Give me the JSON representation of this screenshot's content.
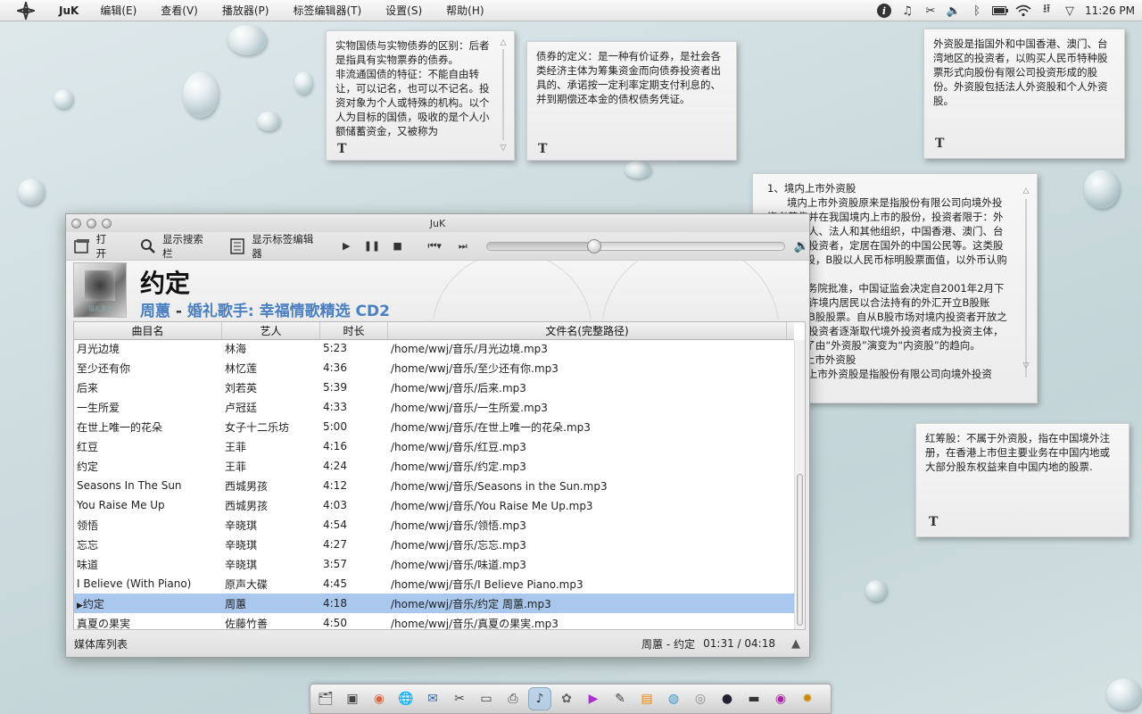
{
  "menubar": {
    "app_name": "JuK",
    "menus": [
      "编辑(E)",
      "查看(V)",
      "播放器(P)",
      "标签编辑器(T)",
      "设置(S)",
      "帮助(H)"
    ],
    "tray_icons": [
      "info-icon",
      "music-note-icon",
      "scissors-icon",
      "volume-icon",
      "bluetooth-icon",
      "battery-icon",
      "wifi-icon",
      "usb-icon",
      "chevron-down-icon"
    ],
    "clock": "11:26 PM"
  },
  "notes": [
    {
      "text": "实物国债与实物债券的区别：后者是指具有实物票券的债券。\n非流通国债的特征：不能自由转让，可以记名，也可以不记名。投资对象为个人或特殊的机构。以个人为目标的国债，吸收的是个人小额储蓄资金，又被称为"
    },
    {
      "text": "债券的定义：是一种有价证券，是社会各类经济主体为筹集资金而向债券投资者出具的、承诺按一定利率定期支付利息的、并到期偿还本金的债权债务凭证。"
    },
    {
      "text": "外资股是指国外和中国香港、澳门、台湾地区的投资者，以购买人民币特种股票形式向股份有限公司投资形成的股份。外资股包括法人外资股和个人外资股。"
    },
    {
      "text": "1、境内上市外资股\n      境内上市外资股原来是指股份有限公司向境外投资者募集并在我国境内上市的股份，投资者限于：外国的自然人、法人和其他组织，中国香港、澳门、台湾地区的投资者，定居在国外的中国公民等。这类股票称为B股，B股以人民币标明股票面值，以外币认购和交易。\n      经国务院批准，中国证监会决定自2001年2月下旬起，允许境内居民以合法持有的外汇开立B股账户，交易B股股票。自从B股市场对境内投资者开放之后，境内投资者逐渐取代境外投资者成为投资主体，B股发生了由“外资股”演变为“内资股”的趋向。\n2、境外上市外资股\n      境外上市外资股是指股份有限公司向境外投资"
    },
    {
      "text": "红筹股：不属于外资股，指在中国境外注册，在香港上市但主要业务在中国内地或大部分股东权益来自中国内地的股票."
    }
  ],
  "window": {
    "title": "JuK",
    "toolbar": {
      "open_label": "打开",
      "search_label": "显示搜索栏",
      "tag_editor_label": "显示标签编辑器"
    },
    "seek_progress": 0.36,
    "now_playing": {
      "title": "约定",
      "artist": "周蕙",
      "separator": " - ",
      "album": "婚礼歌手: 幸福情歌精选 CD2",
      "cover_text": "婚礼歌手"
    },
    "columns": [
      "曲目名",
      "艺人",
      "时长",
      "文件名(完整路径)"
    ],
    "tracks": [
      {
        "title": "月光边境",
        "artist": "林海",
        "length": "5:23",
        "path": "/home/wwj/音乐/月光边境.mp3"
      },
      {
        "title": "至少还有你",
        "artist": "林忆莲",
        "length": "4:36",
        "path": "/home/wwj/音乐/至少还有你.mp3"
      },
      {
        "title": "后来",
        "artist": "刘若英",
        "length": "5:39",
        "path": "/home/wwj/音乐/后来.mp3"
      },
      {
        "title": "一生所爱",
        "artist": "卢冠廷",
        "length": "4:33",
        "path": "/home/wwj/音乐/一生所爱.mp3"
      },
      {
        "title": "在世上唯一的花朵",
        "artist": "女子十二乐坊",
        "length": "5:00",
        "path": "/home/wwj/音乐/在世上唯一的花朵.mp3"
      },
      {
        "title": "红豆",
        "artist": "王菲",
        "length": "4:16",
        "path": "/home/wwj/音乐/红豆.mp3"
      },
      {
        "title": "约定",
        "artist": "王菲",
        "length": "4:24",
        "path": "/home/wwj/音乐/约定.mp3"
      },
      {
        "title": "Seasons In The Sun",
        "artist": "西城男孩",
        "length": "4:12",
        "path": "/home/wwj/音乐/Seasons in the Sun.mp3"
      },
      {
        "title": "You Raise Me Up",
        "artist": "西城男孩",
        "length": "4:03",
        "path": "/home/wwj/音乐/You Raise Me Up.mp3"
      },
      {
        "title": "领悟",
        "artist": "辛晓琪",
        "length": "4:54",
        "path": "/home/wwj/音乐/领悟.mp3"
      },
      {
        "title": "忘忘",
        "artist": "辛晓琪",
        "length": "4:27",
        "path": "/home/wwj/音乐/忘忘.mp3"
      },
      {
        "title": "味道",
        "artist": "辛晓琪",
        "length": "3:57",
        "path": "/home/wwj/音乐/味道.mp3"
      },
      {
        "title": "I Believe (With Piano)",
        "artist": "原声大碟",
        "length": "4:45",
        "path": "/home/wwj/音乐/I Believe Piano.mp3"
      },
      {
        "title": "约定",
        "artist": "周蕙",
        "length": "4:18",
        "path": "/home/wwj/音乐/约定 周蕙.mp3",
        "playing": true
      },
      {
        "title": "真夏の果実",
        "artist": "佐藤竹善",
        "length": "4:50",
        "path": "/home/wwj/音乐/真夏の果実.mp3"
      }
    ],
    "status": {
      "left": "媒体库列表",
      "now": "周蕙 - 约定",
      "time": "01:31 / 04:18"
    }
  },
  "dock": [
    "file-manager-icon",
    "terminal-icon",
    "chrome-icon",
    "globe-icon",
    "thunderbird-icon",
    "tools-icon",
    "document-icon",
    "scanner-icon",
    "juk-icon",
    "paw-icon",
    "video-icon",
    "pen-icon",
    "paint-icon",
    "earth-icon",
    "disk-icon",
    "sphere-icon",
    "monitor-icon",
    "eye-icon",
    "sun-icon"
  ],
  "colors": {
    "accent": "#4a7fc1",
    "selection": "#aac8ee"
  }
}
